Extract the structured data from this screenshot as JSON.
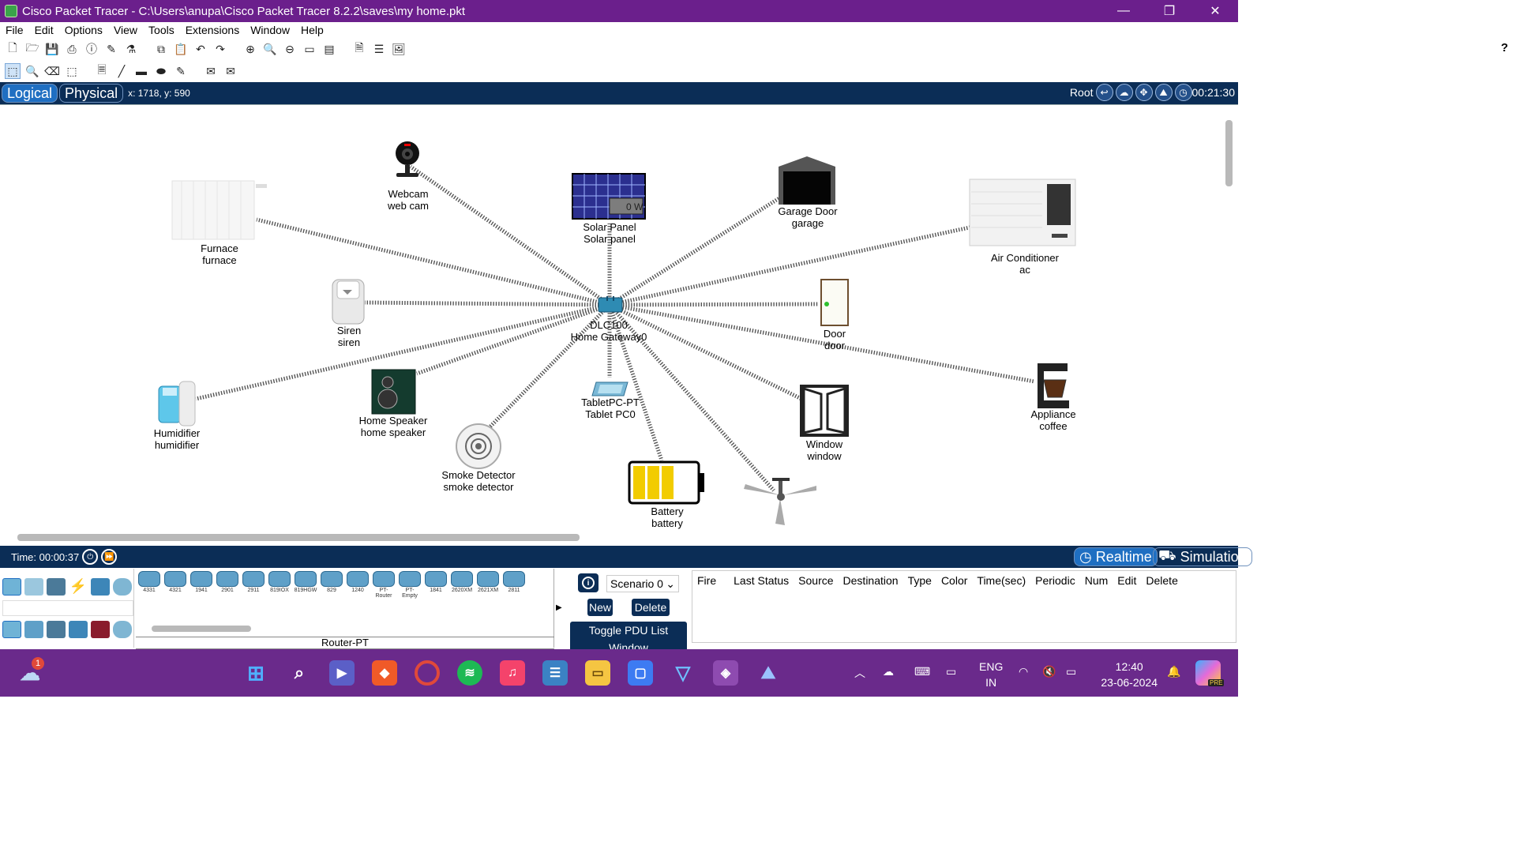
{
  "window": {
    "title": "Cisco Packet Tracer - C:\\Users\\anupa\\Cisco Packet Tracer 8.2.2\\saves\\my home.pkt",
    "minimize": "—",
    "maximize": "❐",
    "close": "✕"
  },
  "menu": [
    "File",
    "Edit",
    "Options",
    "View",
    "Tools",
    "Extensions",
    "Window",
    "Help"
  ],
  "help_symbol": "?",
  "modebar": {
    "logical": "Logical",
    "physical": "Physical",
    "coords": "x: 1718, y: 590",
    "root": "Root",
    "clock": "00:21:30"
  },
  "devices": {
    "webcam": {
      "type": "Webcam",
      "name": "web cam"
    },
    "solar": {
      "type": "Solar Panel",
      "name": "Solar panel",
      "reading": "0 W"
    },
    "garage": {
      "type": "Garage Door",
      "name": "garage"
    },
    "ac": {
      "type": "Air Conditioner",
      "name": "ac"
    },
    "furnace": {
      "type": "Furnace",
      "name": "furnace"
    },
    "siren": {
      "type": "Siren",
      "name": "siren"
    },
    "gateway": {
      "type": "DLC100",
      "name": "Home Gateway0"
    },
    "door": {
      "type": "Door",
      "name": "door"
    },
    "humidifier": {
      "type": "Humidifier",
      "name": "humidifier"
    },
    "speaker": {
      "type": "Home Speaker",
      "name": "home speaker"
    },
    "tablet": {
      "type": "TabletPC-PT",
      "name": "Tablet PC0"
    },
    "appliance": {
      "type": "Appliance",
      "name": "coffee"
    },
    "smoke": {
      "type": "Smoke Detector",
      "name": "smoke detector"
    },
    "battery": {
      "type": "Battery",
      "name": "battery"
    },
    "window": {
      "type": "Window",
      "name": "window"
    }
  },
  "timebar": {
    "time": "Time: 00:00:37",
    "realtime": "Realtime",
    "simulation": "Simulation"
  },
  "device_models": [
    "4331",
    "4321",
    "1941",
    "2901",
    "2911",
    "819IOX",
    "819HGW",
    "829",
    "1240",
    "PT-Router",
    "PT-Empty",
    "1841",
    "2620XM",
    "2621XM",
    "2811"
  ],
  "device_caption": "Router-PT",
  "pdu": {
    "scenario": "Scenario 0",
    "new": "New",
    "delete": "Delete",
    "toggle": "Toggle PDU List Window",
    "columns": [
      "Fire",
      "Last Status",
      "Source",
      "Destination",
      "Type",
      "Color",
      "Time(sec)",
      "Periodic",
      "Num",
      "Edit",
      "Delete"
    ]
  },
  "taskbar": {
    "weather_badge": "1",
    "lang_top": "ENG",
    "lang_bottom": "IN",
    "time": "12:40",
    "date": "23-06-2024",
    "copilot_badge": "PRE"
  },
  "colors": {
    "titlebar": "#6b1f8c",
    "modebar": "#0b2d56",
    "taskbar": "#6a2a8b"
  }
}
